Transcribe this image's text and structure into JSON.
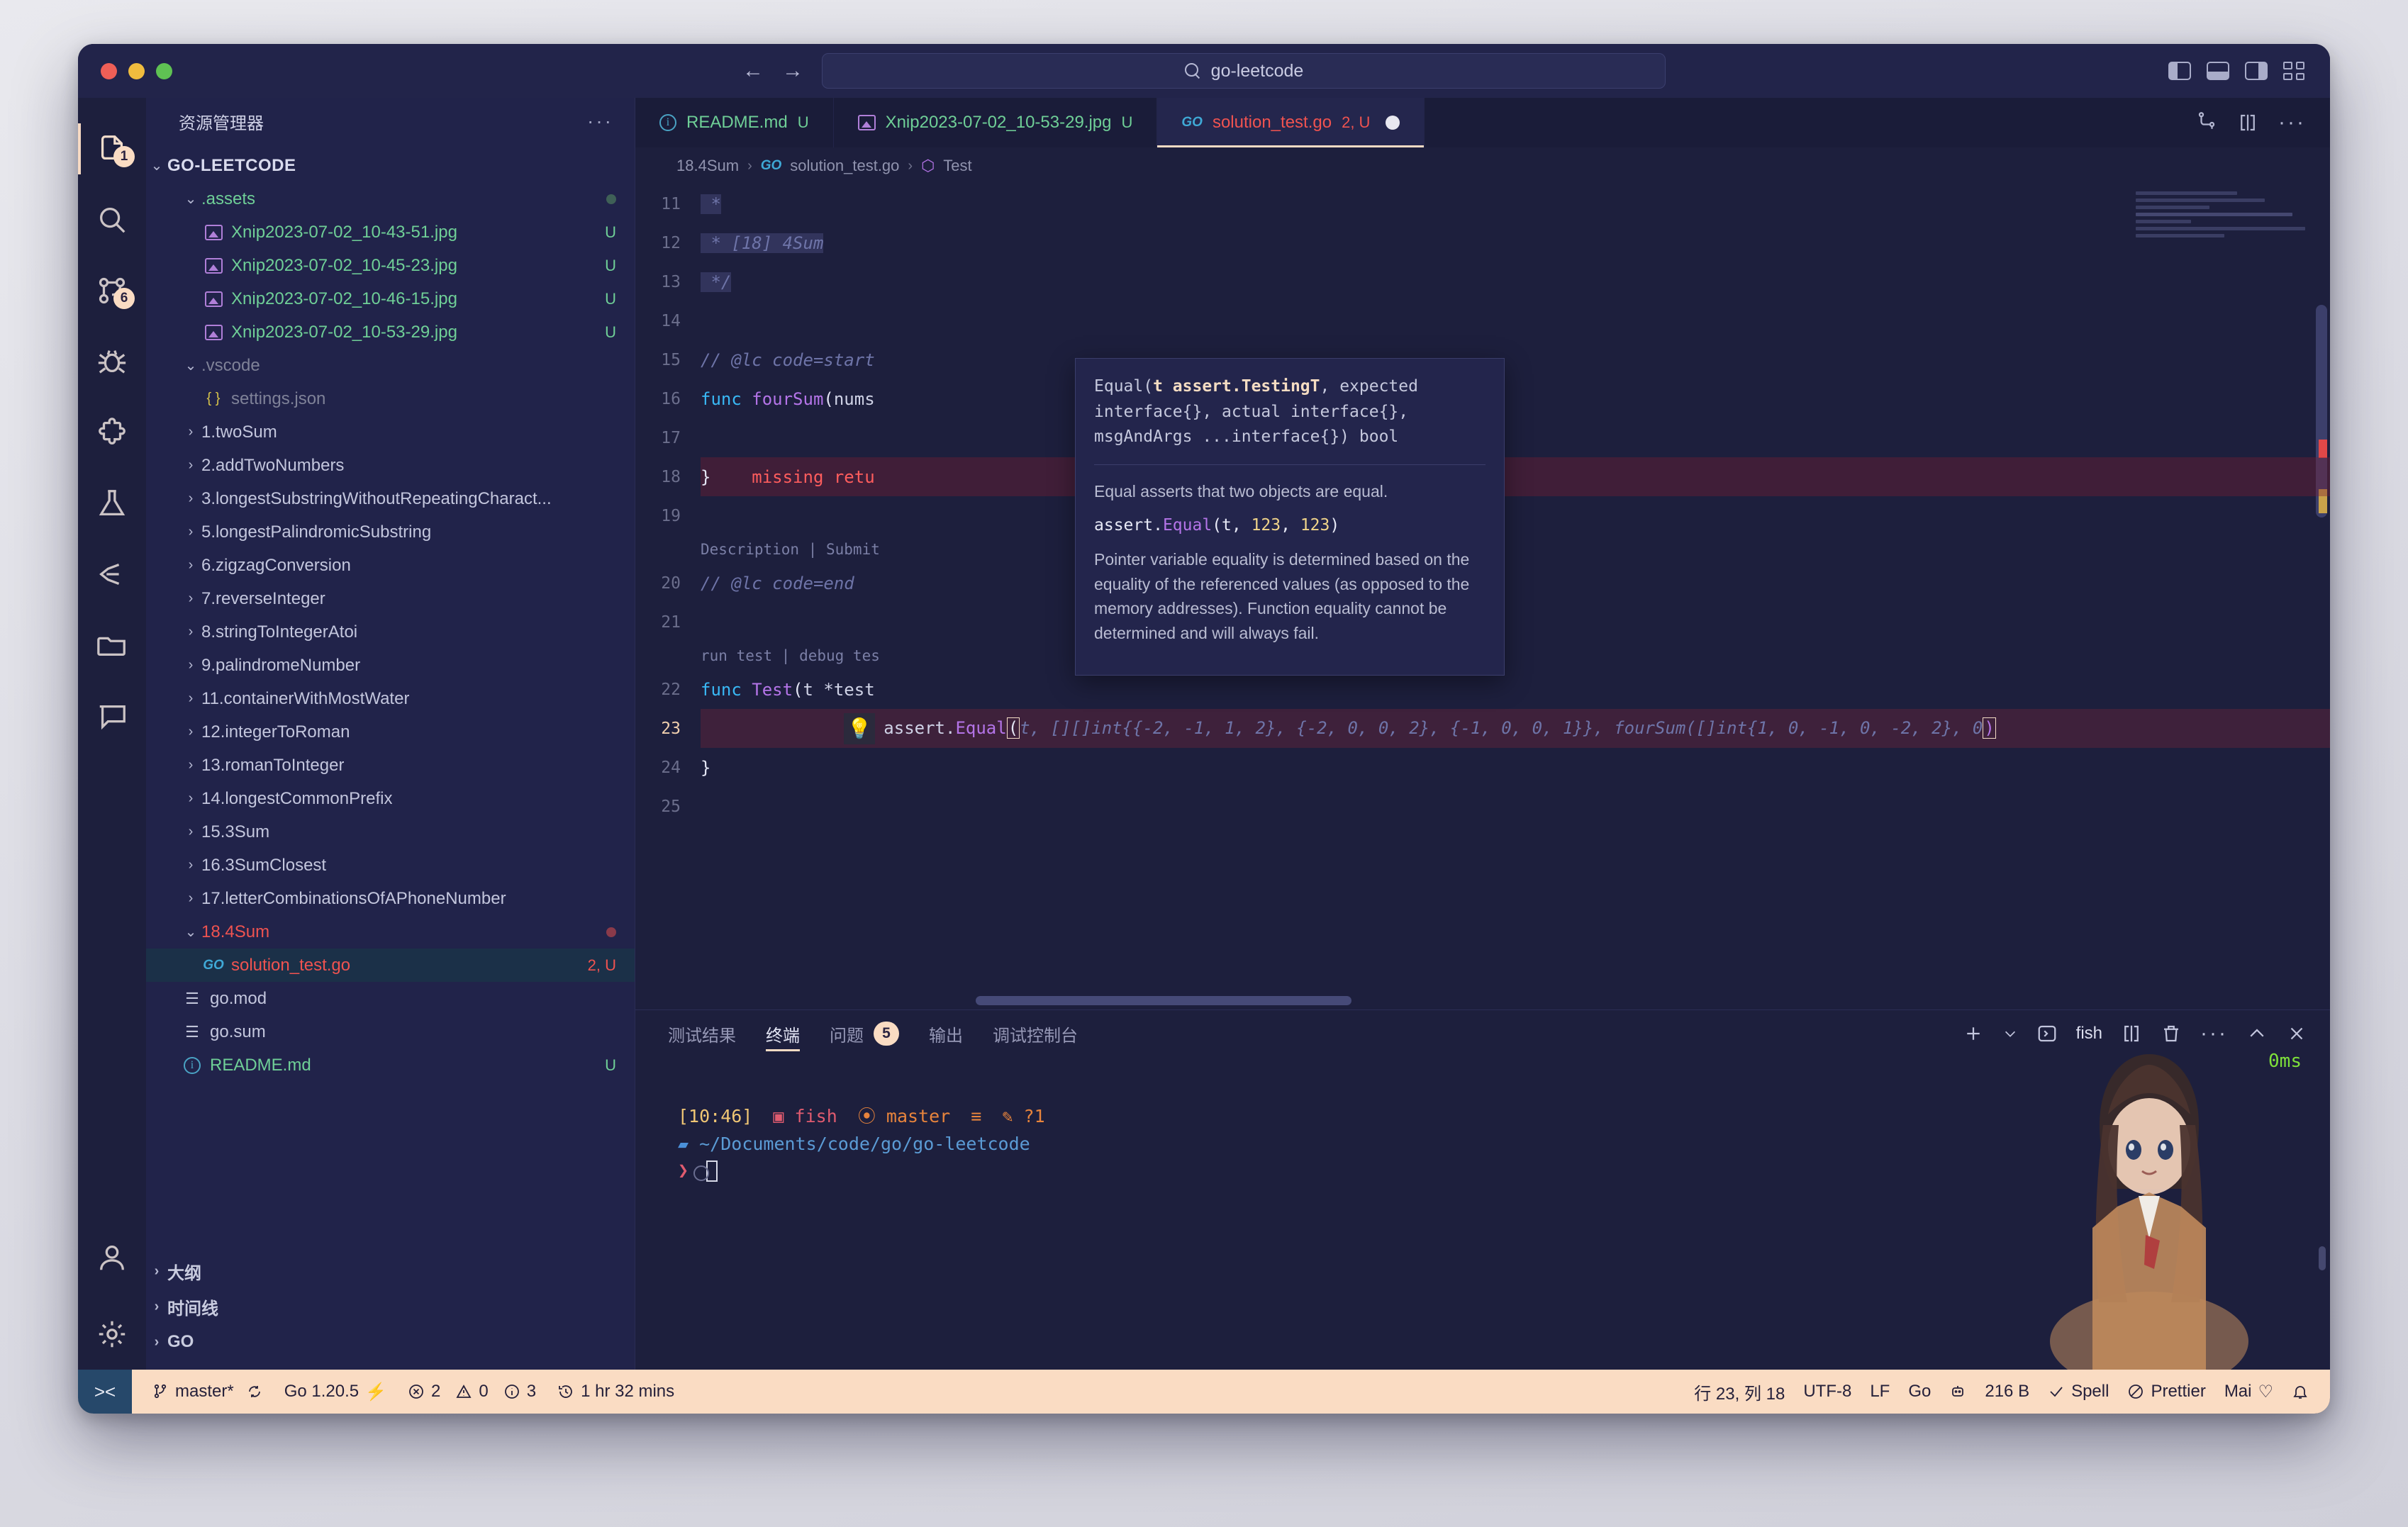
{
  "titlebar": {
    "back_icon": "←",
    "forward_icon": "→",
    "search_value": "go-leetcode",
    "search_icon": "search-icon"
  },
  "activitybar": {
    "items": [
      {
        "name": "explorer",
        "badge": "1",
        "active": true
      },
      {
        "name": "search",
        "badge": "",
        "active": false
      },
      {
        "name": "source-control",
        "badge": "6",
        "active": false
      },
      {
        "name": "run-and-debug",
        "badge": "",
        "active": false
      },
      {
        "name": "extensions",
        "badge": "",
        "active": false
      },
      {
        "name": "testing",
        "badge": "",
        "active": false
      },
      {
        "name": "leetcode",
        "badge": "",
        "active": false
      },
      {
        "name": "remote-explorer",
        "badge": "",
        "active": false
      }
    ],
    "account": "account-icon",
    "settings": "gear-icon"
  },
  "sidebar": {
    "title": "资源管理器",
    "more": "···",
    "root": "GO-LEETCODE",
    "tree": [
      {
        "label": ".assets",
        "indent": 1,
        "type": "folder",
        "open": true,
        "color": "green",
        "status": "",
        "dot": "#3f6057"
      },
      {
        "label": "Xnip2023-07-02_10-43-51.jpg",
        "indent": 2,
        "type": "image",
        "color": "green",
        "status": "U"
      },
      {
        "label": "Xnip2023-07-02_10-45-23.jpg",
        "indent": 2,
        "type": "image",
        "color": "green",
        "status": "U"
      },
      {
        "label": "Xnip2023-07-02_10-46-15.jpg",
        "indent": 2,
        "type": "image",
        "color": "green",
        "status": "U"
      },
      {
        "label": "Xnip2023-07-02_10-53-29.jpg",
        "indent": 2,
        "type": "image",
        "color": "green",
        "status": "U"
      },
      {
        "label": ".vscode",
        "indent": 1,
        "type": "folder",
        "open": true,
        "color": "grey",
        "status": ""
      },
      {
        "label": "settings.json",
        "indent": 2,
        "type": "json",
        "color": "grey",
        "status": ""
      },
      {
        "label": "1.twoSum",
        "indent": 1,
        "type": "folder",
        "open": false,
        "color": "",
        "status": ""
      },
      {
        "label": "2.addTwoNumbers",
        "indent": 1,
        "type": "folder",
        "open": false,
        "color": "",
        "status": ""
      },
      {
        "label": "3.longestSubstringWithoutRepeatingCharact...",
        "indent": 1,
        "type": "folder",
        "open": false,
        "color": "",
        "status": ""
      },
      {
        "label": "5.longestPalindromicSubstring",
        "indent": 1,
        "type": "folder",
        "open": false,
        "color": "",
        "status": ""
      },
      {
        "label": "6.zigzagConversion",
        "indent": 1,
        "type": "folder",
        "open": false,
        "color": "",
        "status": ""
      },
      {
        "label": "7.reverseInteger",
        "indent": 1,
        "type": "folder",
        "open": false,
        "color": "",
        "status": ""
      },
      {
        "label": "8.stringToIntegerAtoi",
        "indent": 1,
        "type": "folder",
        "open": false,
        "color": "",
        "status": ""
      },
      {
        "label": "9.palindromeNumber",
        "indent": 1,
        "type": "folder",
        "open": false,
        "color": "",
        "status": ""
      },
      {
        "label": "11.containerWithMostWater",
        "indent": 1,
        "type": "folder",
        "open": false,
        "color": "",
        "status": ""
      },
      {
        "label": "12.integerToRoman",
        "indent": 1,
        "type": "folder",
        "open": false,
        "color": "",
        "status": ""
      },
      {
        "label": "13.romanToInteger",
        "indent": 1,
        "type": "folder",
        "open": false,
        "color": "",
        "status": ""
      },
      {
        "label": "14.longestCommonPrefix",
        "indent": 1,
        "type": "folder",
        "open": false,
        "color": "",
        "status": ""
      },
      {
        "label": "15.3Sum",
        "indent": 1,
        "type": "folder",
        "open": false,
        "color": "",
        "status": ""
      },
      {
        "label": "16.3SumClosest",
        "indent": 1,
        "type": "folder",
        "open": false,
        "color": "",
        "status": ""
      },
      {
        "label": "17.letterCombinationsOfAPhoneNumber",
        "indent": 1,
        "type": "folder",
        "open": false,
        "color": "",
        "status": ""
      },
      {
        "label": "18.4Sum",
        "indent": 1,
        "type": "folder",
        "open": true,
        "color": "red",
        "status": "",
        "dot": "#8a3a4a"
      },
      {
        "label": "solution_test.go",
        "indent": 2,
        "type": "go",
        "color": "red",
        "status": "2, U",
        "selected": true
      },
      {
        "label": "go.mod",
        "indent": 1,
        "type": "lines",
        "color": "",
        "status": ""
      },
      {
        "label": "go.sum",
        "indent": 1,
        "type": "lines",
        "color": "",
        "status": ""
      },
      {
        "label": "README.md",
        "indent": 1,
        "type": "info",
        "color": "green",
        "status": "U"
      }
    ],
    "sections": [
      "大纲",
      "时间线",
      "GO"
    ]
  },
  "editor": {
    "tabs": [
      {
        "label": "README.md",
        "status": "U",
        "icon": "info-icon",
        "active": false,
        "modified": false
      },
      {
        "label": "Xnip2023-07-02_10-53-29.jpg",
        "status": "U",
        "icon": "image-icon",
        "active": false,
        "modified": false
      },
      {
        "label": "solution_test.go",
        "status": "2, U",
        "icon": "go-icon",
        "active": true,
        "modified": true
      }
    ],
    "actions": [
      "split-editor-icon",
      "split-terminal-icon",
      "more-actions-icon"
    ],
    "breadcrumb": [
      "18.4Sum",
      "solution_test.go",
      "Test"
    ],
    "lines": [
      {
        "n": "11",
        "text": " *"
      },
      {
        "n": "12",
        "text": " * [18] 4Sum"
      },
      {
        "n": "13",
        "text": " */"
      },
      {
        "n": "14",
        "text": ""
      },
      {
        "n": "15",
        "text": "// @lc code=start"
      },
      {
        "n": "16",
        "text": "func fourSum(nums"
      },
      {
        "n": "17",
        "text": ""
      },
      {
        "n": "18",
        "text": "}",
        "error": "missing retu"
      },
      {
        "n": "19",
        "text": ""
      },
      {
        "n": "20",
        "text": "// @lc code=end",
        "codelens": "Description | Submit"
      },
      {
        "n": "21",
        "text": ""
      },
      {
        "n": "22",
        "text": "func Test(t *test",
        "codelens": "run test | debug tes"
      },
      {
        "n": "23",
        "text": "assert.Equal(t, [][]int{{-2, -1, 1, 2}, {-2, 0, 0, 2}, {-1, 0, 0, 1}}, fourSum([]int{1, 0, -1, 0, -2, 2}, 0)",
        "current": true,
        "bulb": "💡"
      },
      {
        "n": "24",
        "text": "}"
      },
      {
        "n": "25",
        "text": ""
      }
    ],
    "hover": {
      "signature_pre": "Equal(",
      "signature_bold": "t assert.TestingT",
      "signature_post": ", expected interface{}, actual interface{}, msgAndArgs ...interface{}) bool",
      "desc1": "Equal asserts that two objects are equal.",
      "example_pre": "assert.",
      "example_fn": "Equal",
      "example_mid": "(t, ",
      "example_n1": "123",
      "example_sep": ", ",
      "example_n2": "123",
      "example_end": ")",
      "desc2": "Pointer variable equality is determined based on the equality of the referenced values (as opposed to the memory addresses). Function equality cannot be determined and will always fail."
    }
  },
  "panel": {
    "tabs": [
      {
        "label": "测试结果",
        "badge": "",
        "active": false
      },
      {
        "label": "终端",
        "badge": "",
        "active": true
      },
      {
        "label": "问题",
        "badge": "5",
        "active": false
      },
      {
        "label": "输出",
        "badge": "",
        "active": false
      },
      {
        "label": "调试控制台",
        "badge": "",
        "active": false
      }
    ],
    "actions": {
      "add": "add-terminal-icon",
      "chevron": "chevron-down-icon",
      "shell_name": "fish",
      "split": "split-terminal-icon",
      "kill": "trash-icon",
      "more": "more-actions-icon",
      "maximize": "chevron-up-icon",
      "close": "close-icon"
    },
    "terminal": {
      "time": "[10:46]",
      "shell": "fish",
      "branch": "master",
      "git_extra": "≡",
      "modified": "?1",
      "path": "~/Documents/code/go/go-leetcode",
      "prompt": "❯",
      "timing": "0ms"
    }
  },
  "statusbar": {
    "remote_icon": "remote-window-icon",
    "branch": "master*",
    "sync_icon": "sync-icon",
    "go_version": "Go 1.20.5",
    "errors": "2",
    "warnings": "0",
    "infos": "3",
    "time_tracked": "1 hr 32 mins",
    "cursor_position": "行 23, 列 18",
    "encoding": "UTF-8",
    "eol": "LF",
    "language": "Go",
    "robot_icon": "robot-icon",
    "filesize": "216 B",
    "spell": "Spell",
    "prettier": "Prettier",
    "mai": "Mai",
    "bell_icon": "bell-icon"
  }
}
